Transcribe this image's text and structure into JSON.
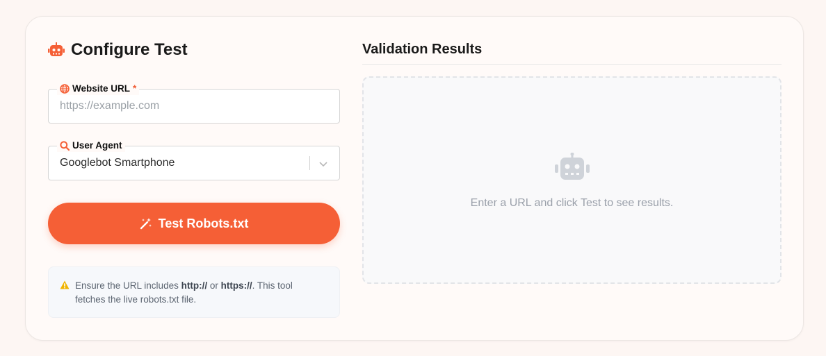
{
  "config": {
    "title": "Configure Test",
    "title_icon": "robot-icon",
    "url_field": {
      "label": "Website URL",
      "required_mark": "*",
      "icon": "globe-icon",
      "placeholder": "https://example.com",
      "value": ""
    },
    "ua_field": {
      "label": "User Agent",
      "icon": "search-icon",
      "selected": "Googlebot Smartphone"
    },
    "test_button": {
      "label": "Test Robots.txt",
      "icon": "magic-wand-icon"
    },
    "note": {
      "icon": "warning-icon",
      "part1": "Ensure the URL includes ",
      "bold1": "http://",
      "part2": " or ",
      "bold2": "https://",
      "part3": ". This tool fetches the live robots.txt file."
    }
  },
  "results": {
    "title": "Validation Results",
    "empty_icon": "robot-icon",
    "empty_message": "Enter a URL and click Test to see results."
  },
  "colors": {
    "accent": "#f55f36",
    "warning": "#f0b400",
    "page_bg": "#fdf6f3"
  }
}
